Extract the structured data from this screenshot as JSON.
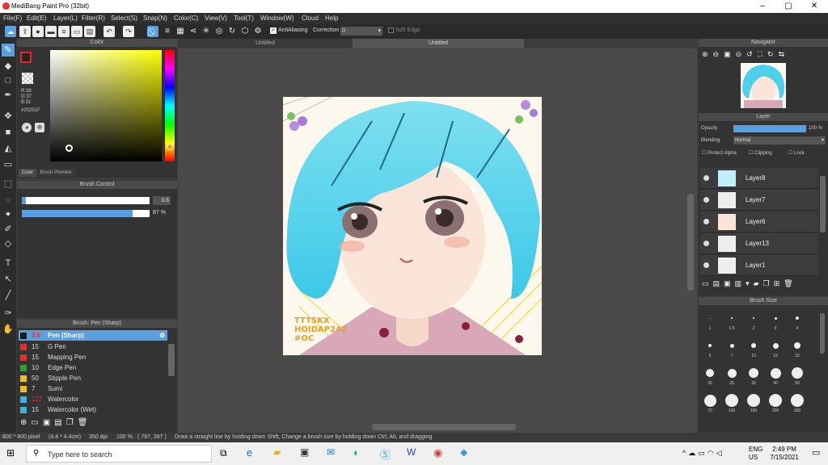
{
  "app": {
    "title": "MediBang Paint Pro (32bit)"
  },
  "menu": [
    "File(F)",
    "Edit(E)",
    "Layer(L)",
    "Filter(R)",
    "Select(S)",
    "Snap(N)",
    "Color(C)",
    "View(V)",
    "Tool(T)",
    "Window(W)",
    "Cloud",
    "Help"
  ],
  "toolbar": {
    "antialiasing": "AntiAliasing",
    "correction_label": "Correction",
    "correction_value": "0",
    "soft_edge": "Soft Edge"
  },
  "tabs": [
    "Untitled",
    "Untitled"
  ],
  "color_panel": {
    "title": "Color",
    "r": "R:38",
    "g": "G:37",
    "b": "B:31",
    "hex": "#20251F",
    "tab_color": "Color",
    "tab_preview": "Brush Preview",
    "accent": "#e22222"
  },
  "brush_control": {
    "title": "Brush Control",
    "size_value": "3.6",
    "opacity_value": "87 %",
    "opacity_fraction": 0.87,
    "size_fraction": 0.03
  },
  "brush_list": {
    "title": "Brush: Pen (Sharp)",
    "items": [
      {
        "size": "3.6",
        "name": "Pen (Sharp)",
        "color": "#1a1a1a",
        "selected": true
      },
      {
        "size": "15",
        "name": "G Pen",
        "color": "#e03030"
      },
      {
        "size": "15",
        "name": "Mapping Pen",
        "color": "#e03030"
      },
      {
        "size": "10",
        "name": "Edge Pen",
        "color": "#30a030"
      },
      {
        "size": "50",
        "name": "Stipple Pen",
        "color": "#e8c020"
      },
      {
        "size": "7",
        "name": "Sumi",
        "color": "#e8c020"
      },
      {
        "size": "127",
        "name": "Watercolor",
        "color": "#40b0e0"
      },
      {
        "size": "15",
        "name": "Watercolor (Wet)",
        "color": "#40b0e0"
      }
    ]
  },
  "canvas": {
    "watermark_lines": [
      "TTTSKX",
      "HOIDAP247",
      "#OC"
    ]
  },
  "navigator": {
    "title": "Navigator"
  },
  "layer_panel": {
    "title": "Layer",
    "opacity_label": "Opacity",
    "opacity_value": "100 %",
    "blending_label": "Blending",
    "blending_value": "Normal",
    "protect_alpha": "Protect Alpha",
    "clipping": "Clipping",
    "lock": "Lock",
    "layers": [
      "Layer8",
      "Layer7",
      "Layer6",
      "Layer13",
      "Layer1"
    ]
  },
  "brush_size": {
    "title": "Brush Size",
    "labels": [
      "1",
      "1.5",
      "2",
      "3",
      "4",
      "5",
      "7",
      "10",
      "12",
      "15",
      "20",
      "25",
      "30",
      "40",
      "50",
      "70",
      "100",
      "150",
      "200",
      "300"
    ]
  },
  "status": {
    "size": "800 * 800 pixel",
    "cm": "(4.4 * 4.4cm)",
    "dpi": "350 dpi",
    "zoom": "100 %",
    "coords": "( 797, 287 )",
    "hint": "Draw a straight line by holding down Shift, Change a brush size by holding down Ctrl, Alt, and dragging"
  },
  "taskbar": {
    "search_placeholder": "Type here to search",
    "lang": "ENG",
    "region": "US",
    "time": "2:49 PM",
    "date": "7/15/2021"
  }
}
